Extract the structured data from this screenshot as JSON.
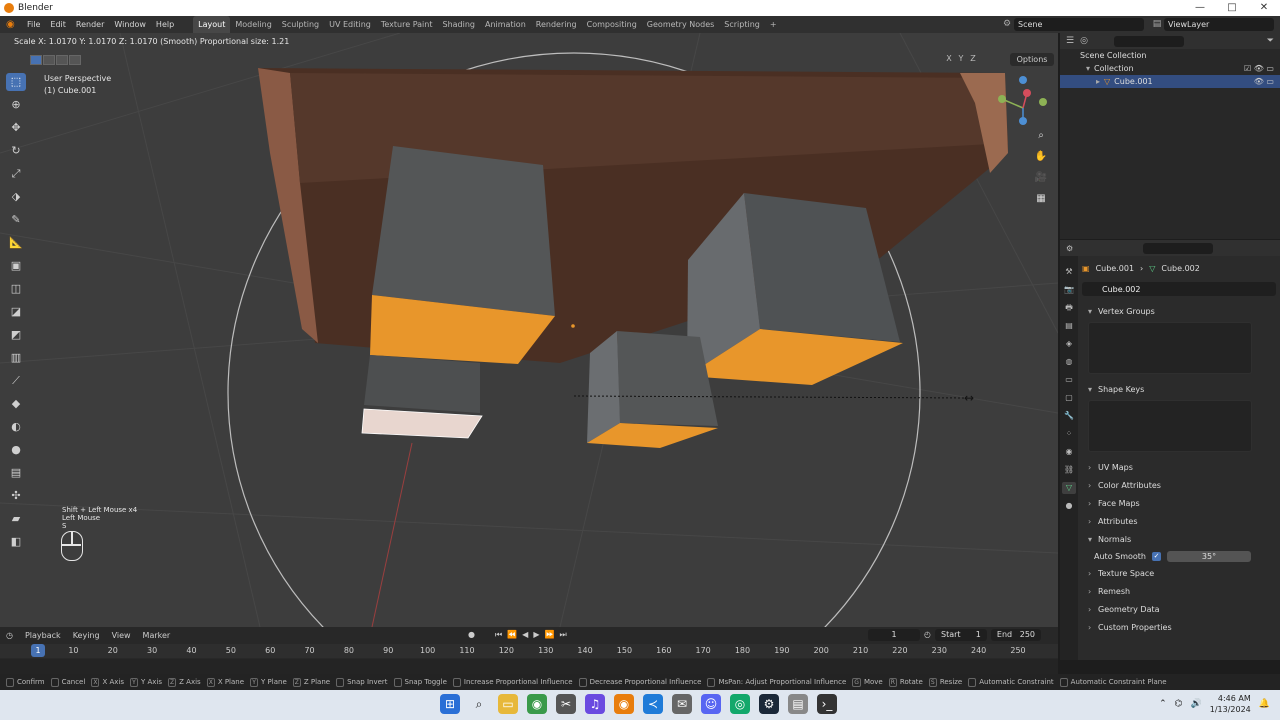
{
  "window": {
    "title": "Blender",
    "controls": [
      "—",
      "□",
      "✕"
    ]
  },
  "menubar": {
    "menus": [
      "File",
      "Edit",
      "Render",
      "Window",
      "Help"
    ],
    "workspaces": [
      "Layout",
      "Modeling",
      "Sculpting",
      "UV Editing",
      "Texture Paint",
      "Shading",
      "Animation",
      "Rendering",
      "Compositing",
      "Geometry Nodes",
      "Scripting"
    ],
    "active_workspace": "Layout",
    "add_tab": "+",
    "scene": "Scene",
    "view_layer": "ViewLayer"
  },
  "viewport": {
    "status": "Scale X: 1.0170  Y: 1.0170  Z: 1.0170 (Smooth) Proportional size: 1.21",
    "perspective": "User Perspective",
    "object": "(1) Cube.001",
    "options": "Options",
    "axis_toggles": [
      "X",
      "Y",
      "Z"
    ],
    "keycast_line1": "Shift + Left Mouse x4",
    "keycast_line2": "Left Mouse",
    "keycast_line3": "S",
    "tools": [
      "select-box",
      "cursor",
      "move",
      "rotate",
      "scale",
      "transform",
      "annotate",
      "measure",
      "add-cube",
      "extrude",
      "inset",
      "bevel",
      "loop-cut",
      "knife",
      "poly-build",
      "spin",
      "smooth",
      "edge-slide",
      "shrink-fatten",
      "shear",
      "rip"
    ],
    "nav": [
      "zoom",
      "pan",
      "camera",
      "ortho"
    ]
  },
  "outliner": {
    "rows": [
      {
        "label": "Scene Collection"
      },
      {
        "label": "Collection"
      },
      {
        "label": "Cube.001"
      }
    ]
  },
  "properties": {
    "breadcrumb_object": "Cube.001",
    "breadcrumb_mesh": "Cube.002",
    "mesh_name": "Cube.002",
    "panels": {
      "vertex_groups": "Vertex Groups",
      "shape_keys": "Shape Keys",
      "uv_maps": "UV Maps",
      "color_attributes": "Color Attributes",
      "face_maps": "Face Maps",
      "attributes": "Attributes",
      "normals": "Normals",
      "texture_space": "Texture Space",
      "remesh": "Remesh",
      "geometry_data": "Geometry Data",
      "custom_properties": "Custom Properties"
    },
    "auto_smooth_label": "Auto Smooth",
    "auto_smooth_checked": true,
    "auto_smooth_angle": "35°"
  },
  "timeline": {
    "menus": [
      "Playback",
      "Keying",
      "View",
      "Marker"
    ],
    "current_frame": "1",
    "start_label": "Start",
    "start": "1",
    "end_label": "End",
    "end": "250",
    "playhead": "1",
    "ticks": [
      "10",
      "20",
      "30",
      "40",
      "50",
      "60",
      "70",
      "80",
      "90",
      "100",
      "110",
      "120",
      "130",
      "140",
      "150",
      "160",
      "170",
      "180",
      "190",
      "200",
      "210",
      "220",
      "230",
      "240",
      "250"
    ]
  },
  "statusbar": {
    "hints": [
      {
        "key": "",
        "label": "Confirm"
      },
      {
        "key": "",
        "label": "Cancel"
      },
      {
        "key": "X",
        "label": "X Axis"
      },
      {
        "key": "Y",
        "label": "Y Axis"
      },
      {
        "key": "Z",
        "label": "Z Axis"
      },
      {
        "key": "X",
        "label": "X Plane"
      },
      {
        "key": "Y",
        "label": "Y Plane"
      },
      {
        "key": "Z",
        "label": "Z Plane"
      },
      {
        "key": "",
        "label": "Snap Invert"
      },
      {
        "key": "",
        "label": "Snap Toggle"
      },
      {
        "key": "",
        "label": "Increase Proportional Influence"
      },
      {
        "key": "",
        "label": "Decrease Proportional Influence"
      },
      {
        "key": "",
        "label": "MsPan: Adjust Proportional Influence"
      },
      {
        "key": "G",
        "label": "Move"
      },
      {
        "key": "R",
        "label": "Rotate"
      },
      {
        "key": "S",
        "label": "Resize"
      },
      {
        "key": "",
        "label": "Automatic Constraint"
      },
      {
        "key": "",
        "label": "Automatic Constraint Plane"
      }
    ]
  },
  "taskbar": {
    "time": "4:46 AM",
    "date": "1/13/2024"
  },
  "colors": {
    "selected_face": "#e8962b",
    "accent": "#4772b3",
    "wood": "#6b4533"
  }
}
